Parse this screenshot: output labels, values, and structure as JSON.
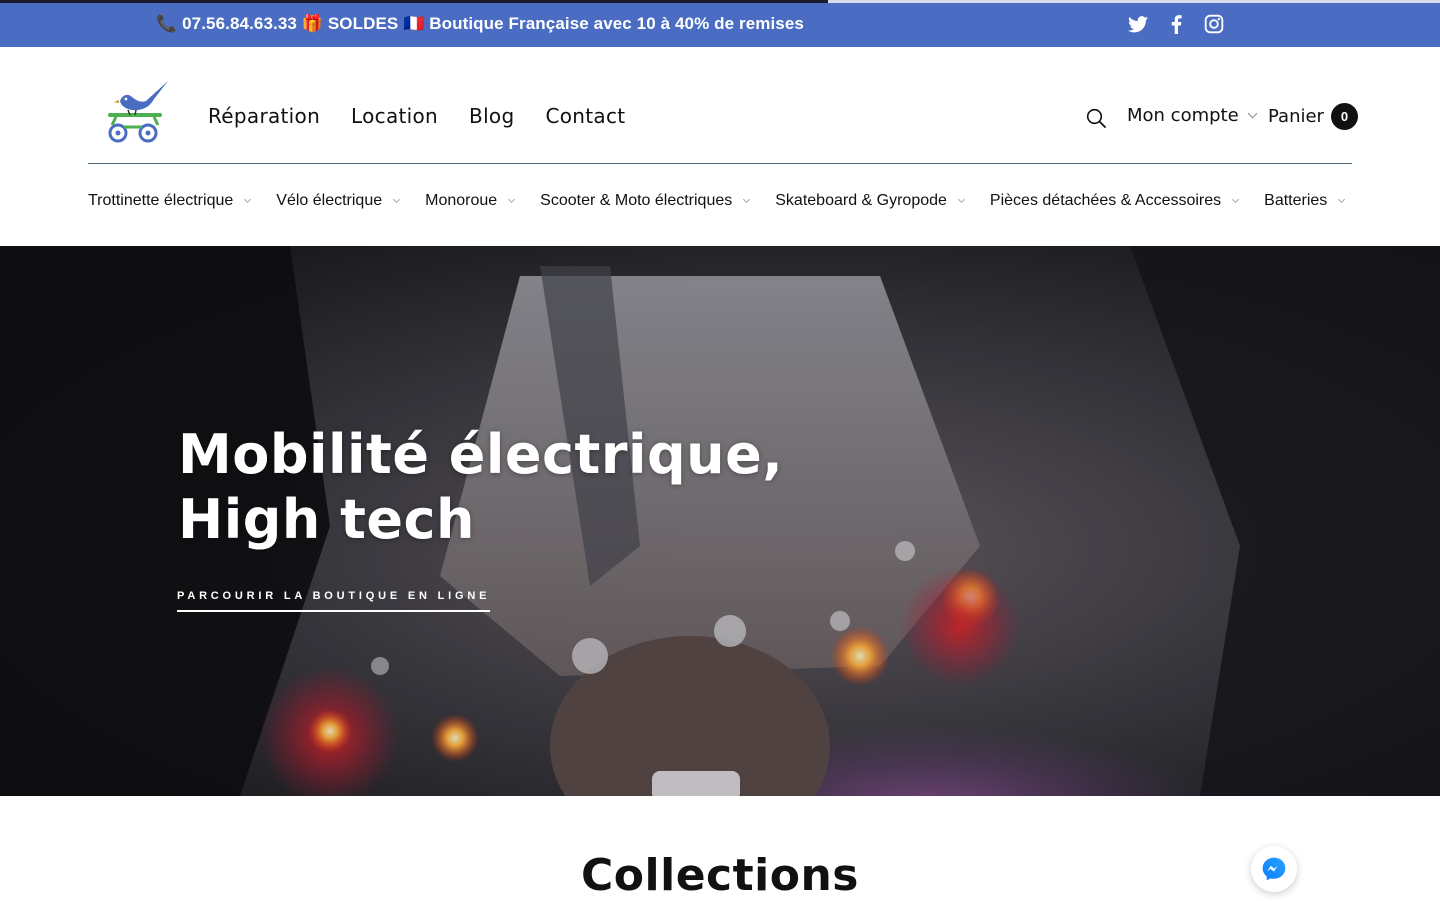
{
  "announcement": {
    "text": "📞 07.56.84.63.33 🎁 SOLDES 🇫🇷 Boutique Française avec 10 à 40% de remises",
    "loading_progress": 0.575
  },
  "social": [
    "twitter-icon",
    "facebook-icon",
    "instagram-icon"
  ],
  "header": {
    "nav": [
      "Réparation",
      "Location",
      "Blog",
      "Contact"
    ],
    "account_label": "Mon compte",
    "cart_label": "Panier",
    "cart_count": "0"
  },
  "categories": [
    "Trottinette électrique",
    "Vélo électrique",
    "Monoroue",
    "Scooter & Moto électriques",
    "Skateboard & Gyropode",
    "Pièces détachées & Accessoires",
    "Batteries"
  ],
  "hero": {
    "title_line1": "Mobilité électrique,",
    "title_line2": "High tech",
    "cta": "PARCOURIR LA BOUTIQUE EN LIGNE"
  },
  "collections": {
    "title": "Collections"
  },
  "colors": {
    "announcement_bg": "#4a6cc2",
    "text": "#111111",
    "accent": "#4a6cc2"
  }
}
